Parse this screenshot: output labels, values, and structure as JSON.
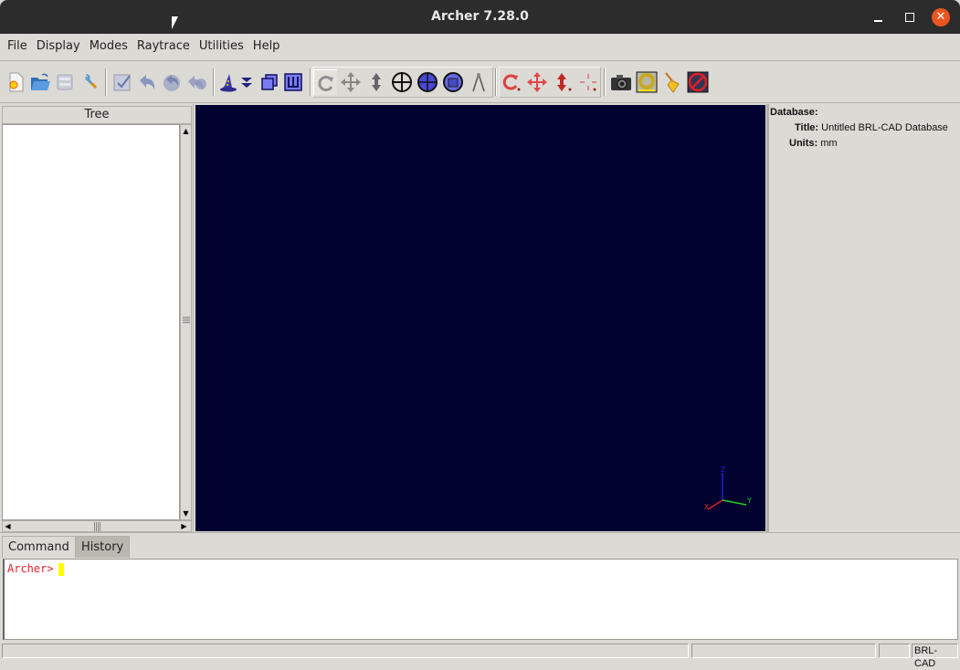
{
  "window": {
    "title": "Archer 7.28.0",
    "controls": {
      "minimize": "minimize",
      "maximize": "maximize",
      "close": "✕"
    }
  },
  "menubar": {
    "items": [
      "File",
      "Display",
      "Modes",
      "Raytrace",
      "Utilities",
      "Help"
    ]
  },
  "toolbar": {
    "buttons": [
      {
        "name": "new-database",
        "icon": "new-file-icon"
      },
      {
        "name": "open-database",
        "icon": "open-folder-icon"
      },
      {
        "name": "save-database",
        "icon": "save-icon",
        "disabled": true
      },
      {
        "name": "preferences",
        "icon": "wrench-icon"
      },
      {
        "name": "commit",
        "icon": "checkmark-icon",
        "disabled": true
      },
      {
        "name": "revert",
        "icon": "undo-icon",
        "disabled": true
      },
      {
        "name": "global-undo",
        "icon": "global-undo-icon",
        "disabled": true
      },
      {
        "name": "redo",
        "icon": "redo-icon",
        "disabled": true
      },
      {
        "name": "wizard",
        "icon": "wizard-hat-icon"
      },
      {
        "name": "wizard-menu",
        "icon": "double-chevron-down-icon"
      },
      {
        "name": "create-combination",
        "icon": "combination-icon"
      },
      {
        "name": "create-region",
        "icon": "region-icon"
      },
      {
        "name": "rotate-view",
        "icon": "rotate-icon",
        "pressed": true
      },
      {
        "name": "translate-view",
        "icon": "move-icon"
      },
      {
        "name": "scale-view",
        "icon": "scale-icon"
      },
      {
        "name": "center-view",
        "icon": "crosshair-icon"
      },
      {
        "name": "component-pick",
        "icon": "component-select-icon"
      },
      {
        "name": "measure-pick",
        "icon": "measure-select-icon"
      },
      {
        "name": "measure-tool",
        "icon": "compass-icon"
      },
      {
        "name": "object-rotate",
        "icon": "object-rotate-icon"
      },
      {
        "name": "object-translate",
        "icon": "object-move-icon"
      },
      {
        "name": "object-scale",
        "icon": "object-scale-icon"
      },
      {
        "name": "object-center",
        "icon": "object-center-icon"
      },
      {
        "name": "raytrace",
        "icon": "camera-icon"
      },
      {
        "name": "raytrace-fb",
        "icon": "framebuffer-icon"
      },
      {
        "name": "clear-fb",
        "icon": "broom-icon"
      },
      {
        "name": "fb-off",
        "icon": "no-framebuffer-icon"
      }
    ]
  },
  "tree": {
    "header": "Tree"
  },
  "viewport": {
    "background": "#020230",
    "axes": {
      "x_label": "X",
      "y_label": "Y",
      "z_label": "Z",
      "x_color": "#e02020",
      "y_color": "#20d020",
      "z_color": "#2020e0"
    }
  },
  "info": {
    "section": "Database:",
    "title_label": "Title:",
    "title_value": "Untitled BRL-CAD Database",
    "units_label": "Units:",
    "units_value": "mm"
  },
  "console": {
    "tabs": [
      "Command",
      "History"
    ],
    "active_tab": "Command",
    "prompt": "Archer>",
    "input": ""
  },
  "statusbar": {
    "main": "",
    "progress": "",
    "extra": "",
    "brand": "BRL-CAD"
  }
}
